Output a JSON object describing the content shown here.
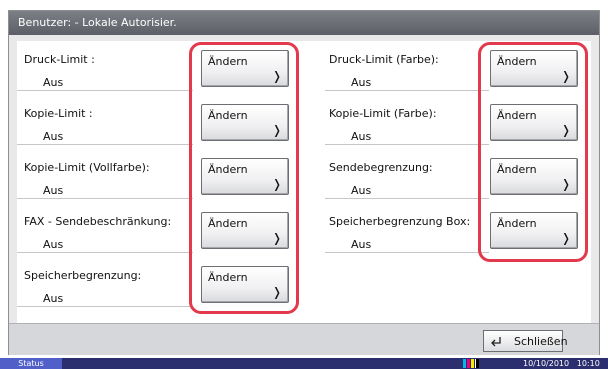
{
  "title": "Benutzer: - Lokale Autorisier.",
  "button_label": "Ändern",
  "items": [
    {
      "label": "Druck-Limit :",
      "value": "Aus"
    },
    {
      "label": "Druck-Limit (Farbe):",
      "value": "Aus"
    },
    {
      "label": "Kopie-Limit :",
      "value": "Aus"
    },
    {
      "label": "Kopie-Limit (Farbe):",
      "value": "Aus"
    },
    {
      "label": "Kopie-Limit (Vollfarbe):",
      "value": "Aus"
    },
    {
      "label": "Sendebegrenzung:",
      "value": "Aus"
    },
    {
      "label": "FAX - Sendebeschränkung:",
      "value": "Aus"
    },
    {
      "label": "Speicherbegrenzung Box:",
      "value": "Aus"
    },
    {
      "label": "Speicherbegrenzung:",
      "value": "Aus"
    }
  ],
  "close_label": "Schließen",
  "status": {
    "label": "Status",
    "datetime": "10/10/2010   10:10"
  },
  "icons": {
    "chevron": "chevron-right-icon",
    "enter": "enter-icon",
    "toner": "toner-level-icon"
  },
  "colors": {
    "highlight": "#e23a4c",
    "titlebar": "#6b6d74",
    "status_bar": "#2b2f70"
  }
}
